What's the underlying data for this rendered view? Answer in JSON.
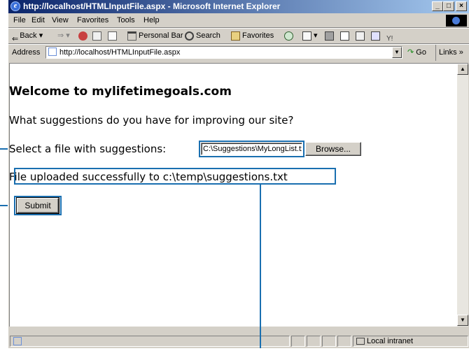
{
  "window": {
    "title": "http://localhost/HTMLInputFile.aspx - Microsoft Internet Explorer",
    "controls": [
      "_",
      "□",
      "×"
    ]
  },
  "menubar": {
    "items": [
      "File",
      "Edit",
      "View",
      "Favorites",
      "Tools",
      "Help"
    ]
  },
  "toolbar": {
    "back": "Back",
    "personal_bar": "Personal Bar",
    "search": "Search",
    "favorites": "Favorites"
  },
  "address": {
    "label": "Address",
    "url": "http://localhost/HTMLInputFile.aspx",
    "go": "Go",
    "links": "Links »"
  },
  "page": {
    "heading": "Welcome to mylifetimegoals.com",
    "question": "What suggestions do you have for improving our site?",
    "file_label": "Select a file with suggestions:",
    "file_value": "C:\\Suggestions\\MyLongList.txt",
    "browse_label": "Browse...",
    "status_message": "File uploaded successfully to c:\\temp\\suggestions.txt",
    "submit_label": "Submit"
  },
  "statusbar": {
    "zone": "Local intranet"
  },
  "colors": {
    "callout": "#1a6fb0",
    "titlebar_start": "#0a246a",
    "titlebar_end": "#a6caf0"
  }
}
